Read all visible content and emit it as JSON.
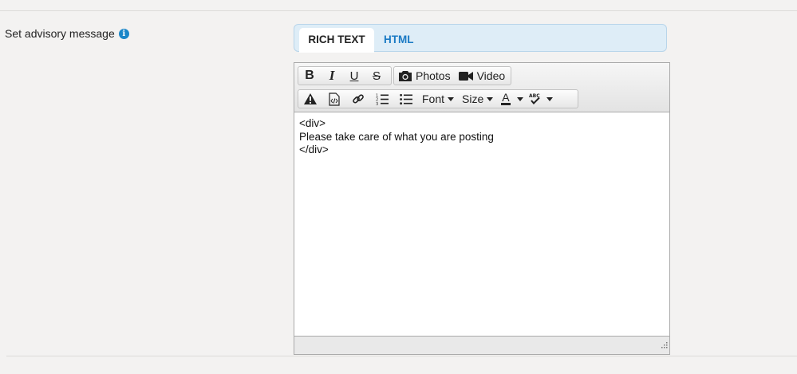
{
  "field": {
    "label": "Set advisory message",
    "info_icon": "info-icon"
  },
  "tabs": [
    {
      "label": "RICH TEXT",
      "active": true
    },
    {
      "label": "HTML",
      "active": false
    }
  ],
  "toolbar": {
    "bold": "B",
    "italic": "I",
    "underline": "U",
    "strikethrough": "S",
    "photos_label": "Photos",
    "video_label": "Video",
    "font_label": "Font",
    "size_label": "Size",
    "text_color_label": "A",
    "icons": [
      "warning-icon",
      "source-code-icon",
      "link-icon",
      "numbered-list-icon",
      "bulleted-list-icon",
      "camera-icon",
      "video-camera-icon",
      "spellcheck-icon"
    ]
  },
  "editor": {
    "content_lines": [
      "<div>",
      "Please take care of what you are posting",
      "</div>"
    ]
  },
  "colors": {
    "tab_link": "#1a7ac4",
    "tab_bar_bg": "#deedf7",
    "info_icon": "#1a86c8"
  }
}
